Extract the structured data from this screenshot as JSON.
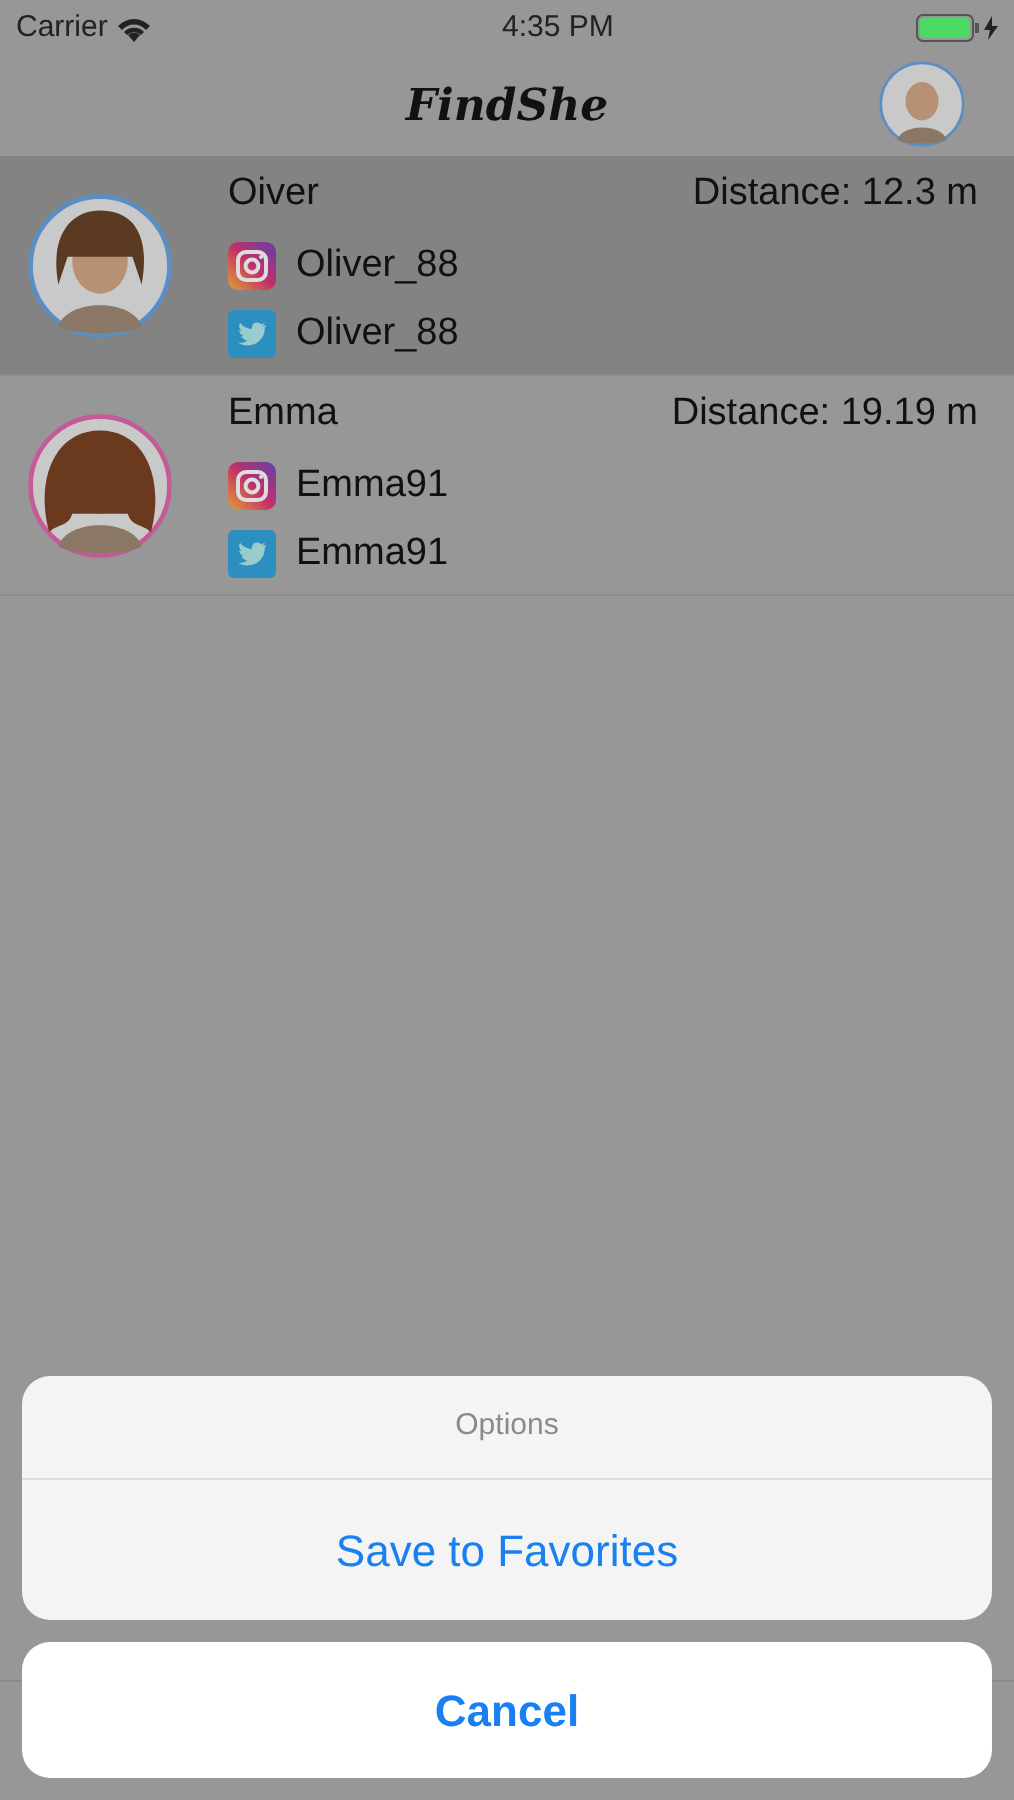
{
  "status_bar": {
    "carrier": "Carrier",
    "time": "4:35 PM",
    "battery_charging": true
  },
  "nav_bar": {
    "title": "FindShe"
  },
  "contacts": [
    {
      "name": "Oiver",
      "distance": "Distance: 12.3 m",
      "instagram": "Oliver_88",
      "twitter": "Oliver_88",
      "selected": true,
      "color": "#5b8fc4",
      "kind": "short"
    },
    {
      "name": "Emma",
      "distance": "Distance: 19.19 m",
      "instagram": "Emma91",
      "twitter": "Emma91",
      "selected": false,
      "color": "#c45a98",
      "kind": "curly"
    }
  ],
  "action_sheet": {
    "title": "Options",
    "actions": [
      "Save to Favorites"
    ],
    "cancel": "Cancel"
  }
}
